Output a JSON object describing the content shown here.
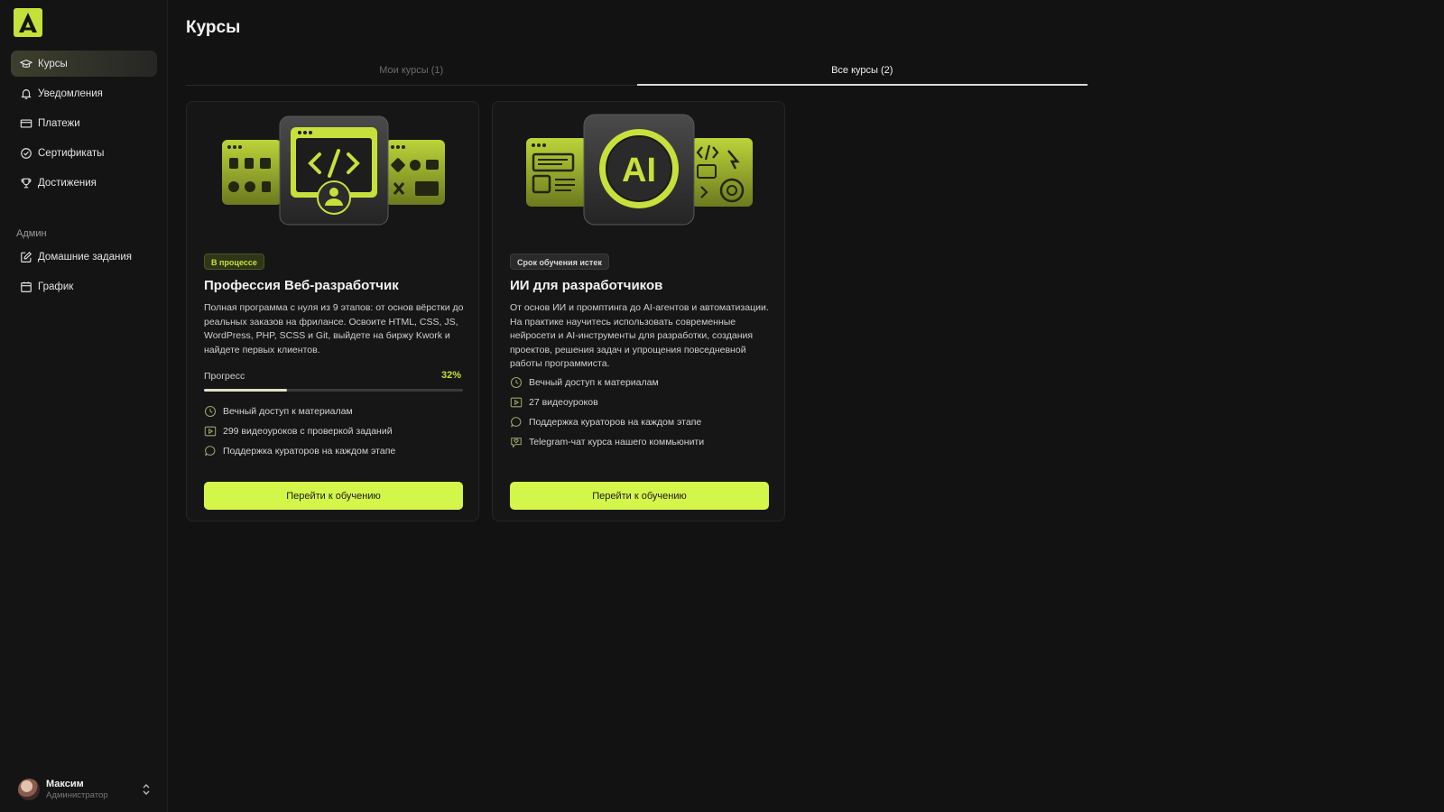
{
  "sidebar": {
    "items": [
      {
        "label": "Курсы",
        "icon": "graduation-cap-icon"
      },
      {
        "label": "Уведомления",
        "icon": "bell-icon"
      },
      {
        "label": "Платежи",
        "icon": "credit-card-icon"
      },
      {
        "label": "Сертификаты",
        "icon": "badge-check-icon"
      },
      {
        "label": "Достижения",
        "icon": "trophy-icon"
      }
    ],
    "section_label": "Админ",
    "admin_items": [
      {
        "label": "Домашние задания",
        "icon": "edit-square-icon"
      },
      {
        "label": "График",
        "icon": "calendar-icon"
      }
    ]
  },
  "user": {
    "name": "Максим",
    "role": "Администратор"
  },
  "page": {
    "title": "Курсы"
  },
  "tabs": [
    {
      "label": "Мои курсы (1)",
      "active": false
    },
    {
      "label": "Все курсы (2)",
      "active": true
    }
  ],
  "courses": [
    {
      "badge": "В процессе",
      "title": "Профессия Веб-разработчик",
      "description": "Полная программа с нуля из 9 этапов: от основ вёрстки до реальных заказов на фрилансе. Освоите HTML, CSS, JS, WordPress, PHP, SCSS и Git, выйдете на биржу Kwork и найдете первых клиентов.",
      "progress_label": "Прогресс",
      "progress_text": "32%",
      "progress_value": 0.32,
      "features": [
        {
          "text": "Вечный доступ к материалам",
          "icon": "clock-icon"
        },
        {
          "text": "299 видеоуроков с проверкой заданий",
          "icon": "video-icon"
        },
        {
          "text": "Поддержка кураторов на каждом этапе",
          "icon": "chat-icon"
        }
      ],
      "button": "Перейти к обучению",
      "banner_icon": "code-window-icon"
    },
    {
      "badge": "Срок обучения истек",
      "title": "ИИ для разработчиков",
      "description": "От основ ИИ и промптинга до AI-агентов и автоматизации. На практике научитесь использовать современные нейросети и AI-инструменты для разработки, создания проектов, решения задач и упрощения повседневной работы программиста.",
      "features": [
        {
          "text": "Вечный доступ к материалам",
          "icon": "clock-icon"
        },
        {
          "text": "27 видеоуроков",
          "icon": "video-icon"
        },
        {
          "text": "Поддержка кураторов на каждом этапе",
          "icon": "chat-icon"
        },
        {
          "text": "Telegram-чат курса нашего коммьюнити",
          "icon": "chat-heart-icon"
        }
      ],
      "button": "Перейти к обучению",
      "banner_text": "AI",
      "banner_icon": "ai-chip-icon"
    }
  ],
  "colors": {
    "accent": "#c4e03a",
    "button": "#d4f54a",
    "background": "#121212"
  }
}
